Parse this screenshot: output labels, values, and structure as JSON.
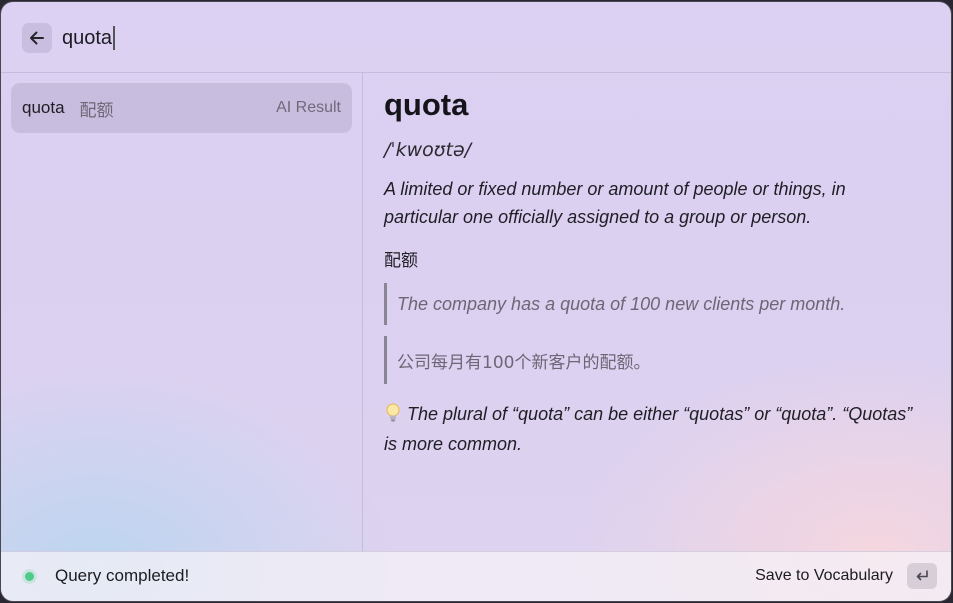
{
  "header": {
    "back_icon": "arrow-left-icon",
    "search_value": "quota"
  },
  "results": [
    {
      "word": "quota",
      "translation": "配额",
      "tag": "AI Result"
    }
  ],
  "entry": {
    "word": "quota",
    "phonetic": "/ˈkwoʊtə/",
    "definition": "A limited or fixed number or amount of people or things, in particular one officially assigned to a group or person.",
    "translation": "配额",
    "example_en": "The company has a quota of 100 new clients per month.",
    "example_zh": "公司每月有100个新客户的配额。",
    "tip_icon": "lightbulb-icon",
    "tip": "The plural of “quota” can be either “quotas” or “quota”. “Quotas” is more common."
  },
  "footer": {
    "status_text": "Query completed!",
    "status_color": "#4ecb8a",
    "save_label": "Save to Vocabulary",
    "enter_icon": "return-key-icon"
  }
}
